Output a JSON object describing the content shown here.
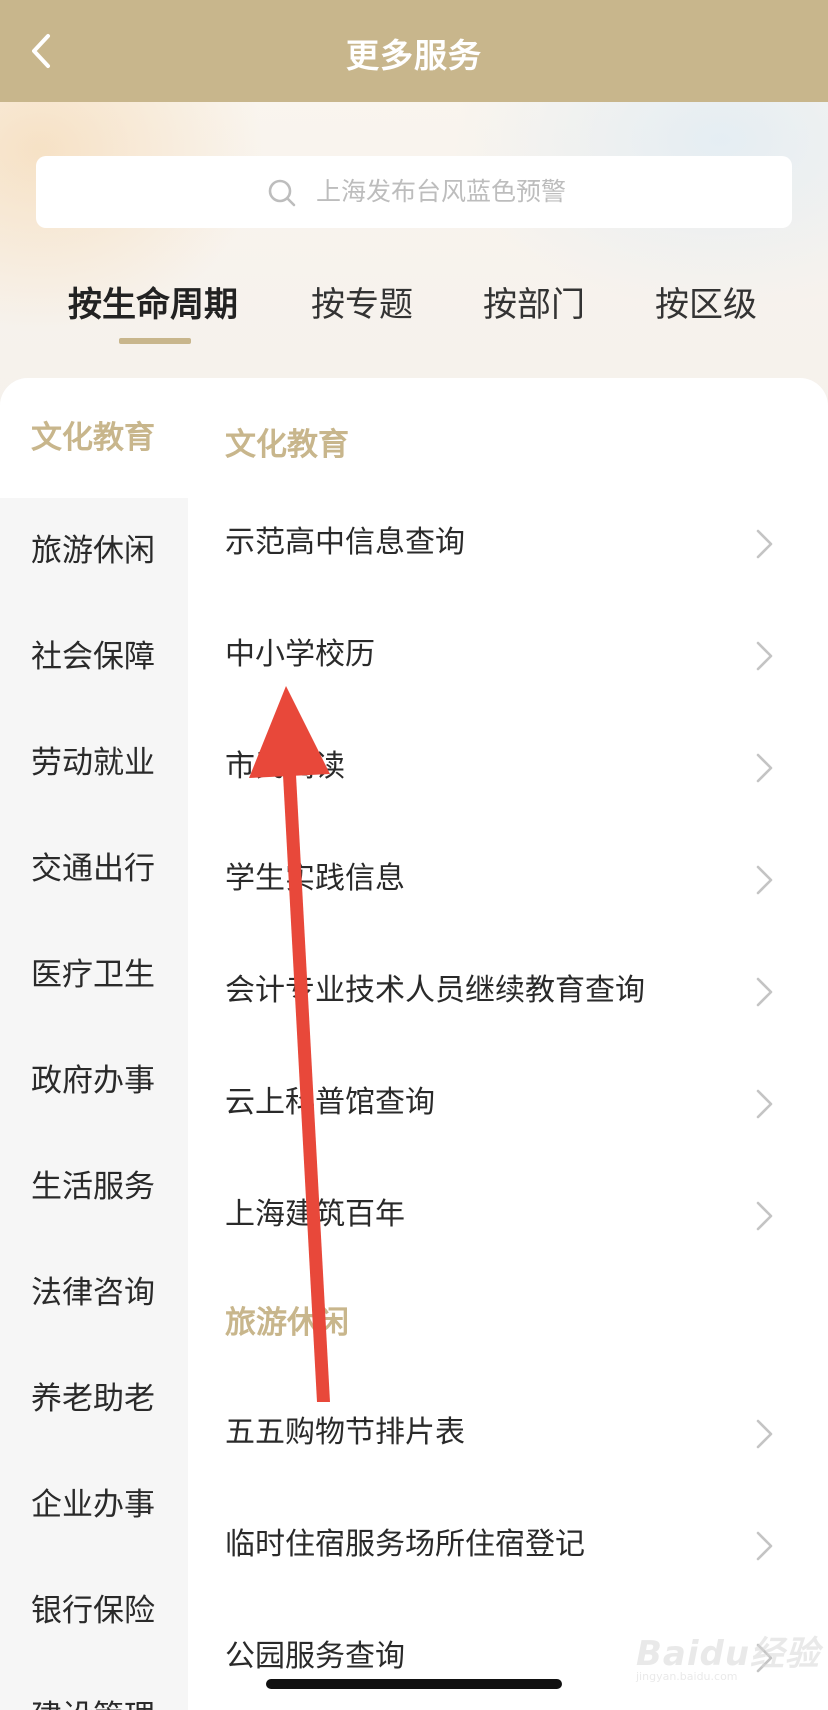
{
  "header": {
    "title": "更多服务",
    "back_icon": "chevron-left-icon"
  },
  "search": {
    "placeholder": "上海发布台风蓝色预警",
    "icon": "search-icon"
  },
  "tabs": [
    {
      "label": "按生命周期",
      "active": true
    },
    {
      "label": "按专题",
      "active": false
    },
    {
      "label": "按部门",
      "active": false
    },
    {
      "label": "按区级",
      "active": false
    }
  ],
  "sidebar": {
    "items": [
      {
        "label": "文化教育",
        "active": true
      },
      {
        "label": "旅游休闲",
        "active": false
      },
      {
        "label": "社会保障",
        "active": false
      },
      {
        "label": "劳动就业",
        "active": false
      },
      {
        "label": "交通出行",
        "active": false
      },
      {
        "label": "医疗卫生",
        "active": false
      },
      {
        "label": "政府办事",
        "active": false
      },
      {
        "label": "生活服务",
        "active": false
      },
      {
        "label": "法律咨询",
        "active": false
      },
      {
        "label": "养老助老",
        "active": false
      },
      {
        "label": "企业办事",
        "active": false
      },
      {
        "label": "银行保险",
        "active": false
      },
      {
        "label": "建设管理",
        "active": false
      }
    ]
  },
  "content": {
    "sections": [
      {
        "title": "文化教育",
        "items": [
          {
            "label": "示范高中信息查询"
          },
          {
            "label": "中小学校历"
          },
          {
            "label": "市民阅读"
          },
          {
            "label": "学生实践信息"
          },
          {
            "label": "会计专业技术人员继续教育查询"
          },
          {
            "label": "云上科普馆查询"
          },
          {
            "label": "上海建筑百年"
          }
        ]
      },
      {
        "title": "旅游休闲",
        "items": [
          {
            "label": "五五购物节排片表"
          },
          {
            "label": "临时住宿服务场所住宿登记"
          },
          {
            "label": "公园服务查询"
          }
        ]
      }
    ]
  },
  "watermark": {
    "text": "Baidu经验",
    "sub": "jingyan.baidu.com"
  },
  "colors": {
    "accent": "#c8b68c",
    "arrow": "#e8483a",
    "text": "#2a2a2a",
    "sidebar_bg": "#f6f6f6"
  }
}
